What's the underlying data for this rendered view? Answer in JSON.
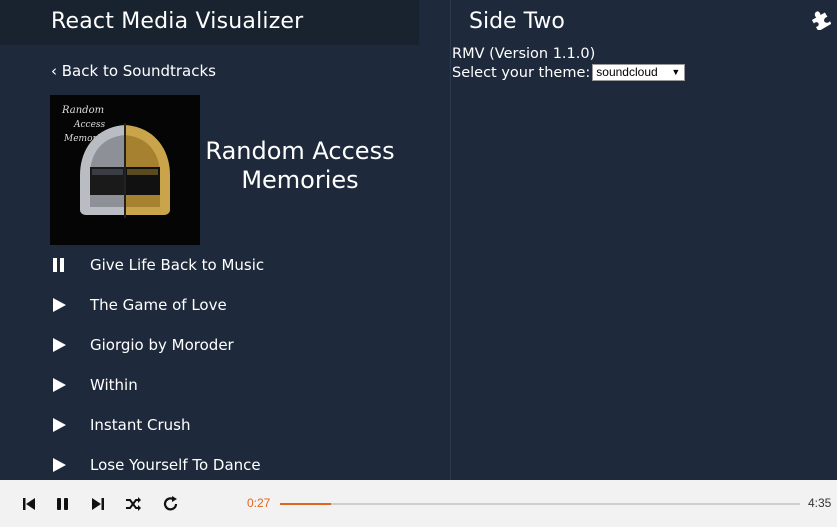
{
  "left": {
    "title": "React Media Visualizer",
    "back_label": "‹ Back to Soundtracks",
    "album": {
      "title": "Random Access Memories",
      "cover_text": "Random Access Memories"
    },
    "tracks": [
      {
        "name": "Give Life Back to Music",
        "state": "playing"
      },
      {
        "name": "The Game of Love",
        "state": "idle"
      },
      {
        "name": "Giorgio by Moroder",
        "state": "idle"
      },
      {
        "name": "Within",
        "state": "idle"
      },
      {
        "name": "Instant Crush",
        "state": "idle"
      },
      {
        "name": "Lose Yourself To Dance",
        "state": "idle"
      }
    ]
  },
  "right": {
    "title": "Side Two",
    "settings_icon": "puzzle-icon",
    "version_text": "RMV (Version 1.1.0)",
    "theme_label": "Select your theme:",
    "theme_selected": "soundcloud"
  },
  "player": {
    "current_time": "0:27",
    "total_time": "4:35",
    "progress": 0.098,
    "accent": "#e0661f",
    "buttons": [
      "skip-previous-icon",
      "pause-icon",
      "skip-next-icon",
      "shuffle-icon",
      "repeat-icon"
    ]
  },
  "colors": {
    "background": "#1e2a3b",
    "header": "#19222f",
    "player_bg": "#f2f2f2"
  }
}
